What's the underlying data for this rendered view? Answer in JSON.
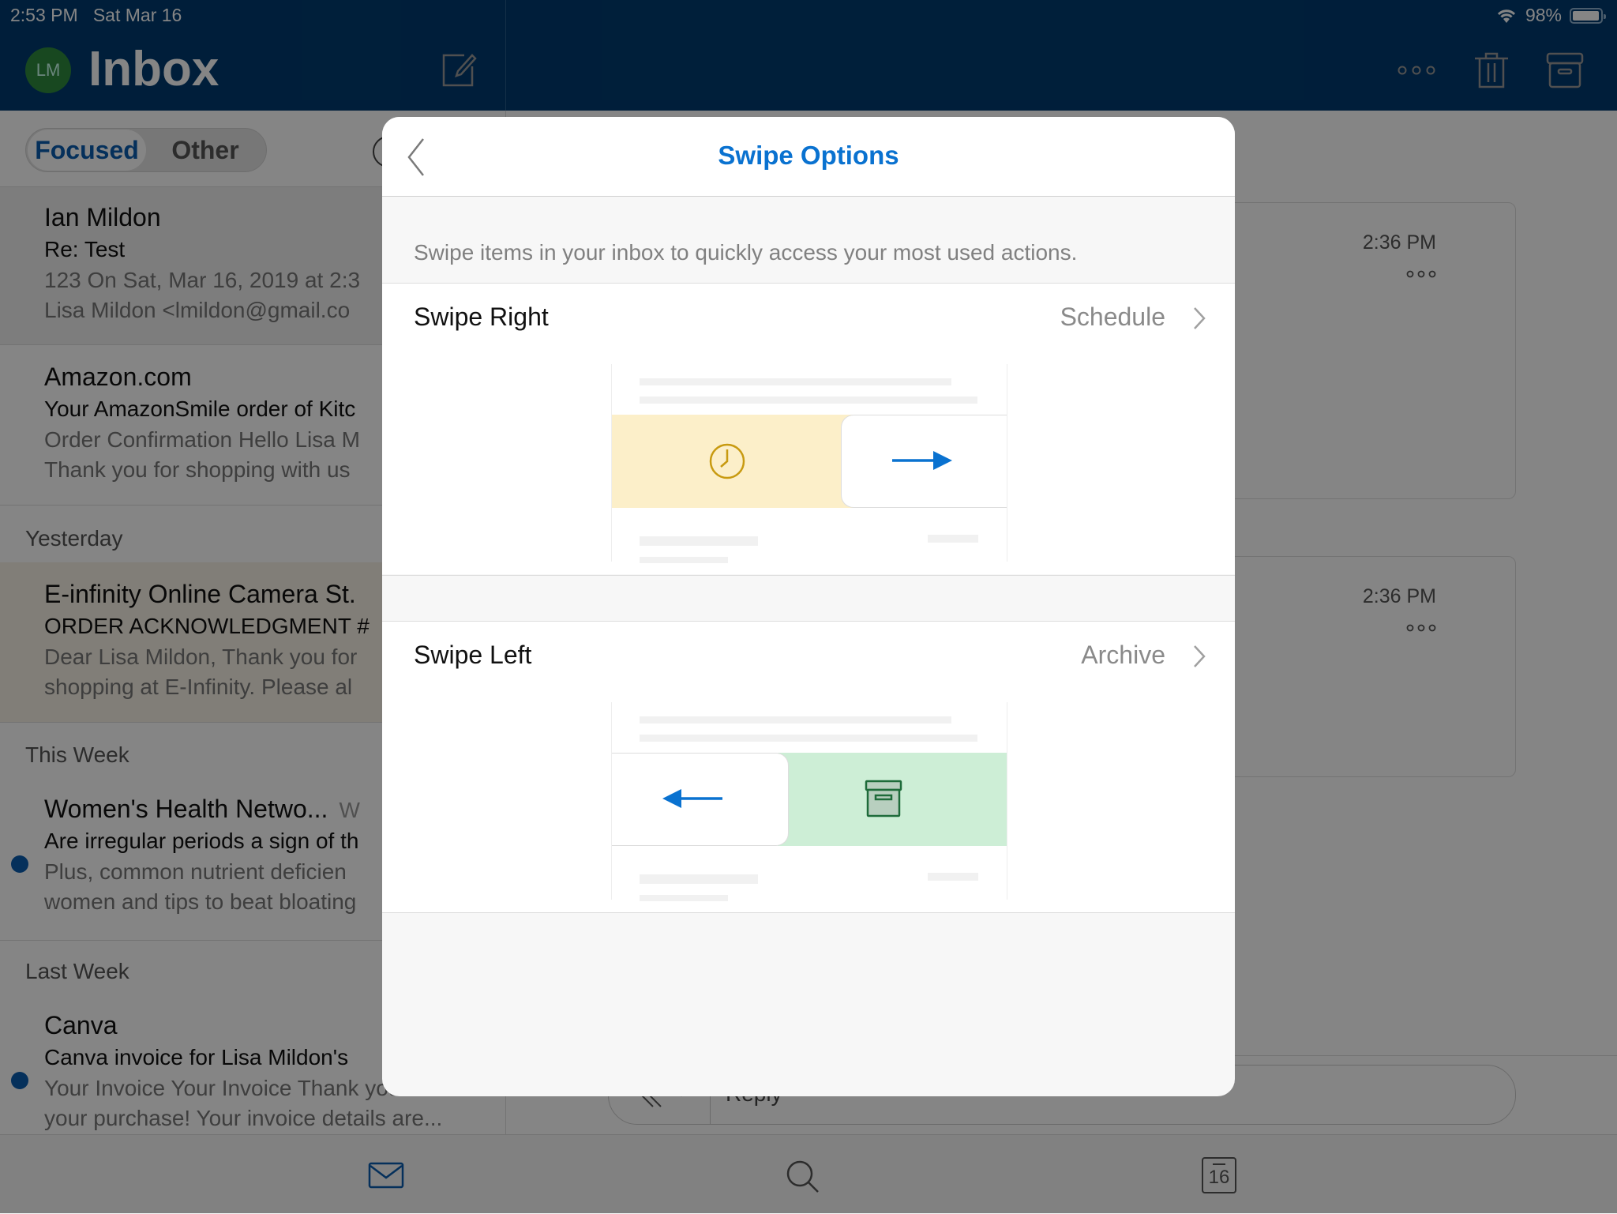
{
  "status_bar": {
    "time": "2:53 PM",
    "date": "Sat Mar 16",
    "battery_percent": "98%",
    "battery_level": 0.98
  },
  "header": {
    "avatar_initials": "LM",
    "title": "Inbox",
    "icons": [
      "compose-icon",
      "more-icon",
      "trash-icon",
      "archive-icon"
    ]
  },
  "colors": {
    "header_bg": "#003b6f",
    "accent": "#0a72d0",
    "schedule_bg": "#fcefc9",
    "schedule_icon": "#c89a10",
    "archive_bg": "#cdeed6",
    "archive_icon": "#1e6b3a",
    "unread_dot": "#0a5cae"
  },
  "inbox_tabs": {
    "focused": "Focused",
    "other": "Other",
    "active": "Focused"
  },
  "mail_list": {
    "items": [
      {
        "sender": "Ian Mildon",
        "subject": "Re: Test",
        "preview1": "123 On Sat, Mar 16, 2019 at 2:3",
        "preview2": "Lisa Mildon <lmildon@gmail.co",
        "unread": false
      },
      {
        "sender": "Amazon.com",
        "subject": "Your AmazonSmile order of Kitc",
        "preview1": "Order Confirmation Hello Lisa M",
        "preview2": "Thank you for shopping with us",
        "unread": false
      },
      {
        "sender": "E-infinity Online Camera St.",
        "subject": "ORDER ACKNOWLEDGMENT #",
        "preview1": "Dear Lisa Mildon, Thank you for",
        "preview2": "shopping at E-Infinity. Please al",
        "unread": false
      },
      {
        "sender": "Women's Health Netwo...",
        "sender_suffix": "W",
        "subject": "Are irregular periods a sign of th",
        "preview1": "Plus, common nutrient deficien",
        "preview2": "women and tips to beat bloating",
        "unread": true
      },
      {
        "sender": "Canva",
        "subject": "Canva invoice for Lisa Mildon's",
        "preview1": "Your Invoice Your Invoice Thank you for",
        "preview2": "your purchase! Your invoice details are...",
        "unread": true
      }
    ],
    "sections": [
      "Yesterday",
      "This Week",
      "Last Week"
    ]
  },
  "reading_pane": {
    "messages": [
      {
        "time": "2:36 PM"
      },
      {
        "time": "2:36 PM"
      }
    ],
    "reply_placeholder": "Reply"
  },
  "tab_bar": {
    "items": [
      "mail-icon",
      "search-icon",
      "calendar-icon"
    ],
    "calendar_day": "16"
  },
  "modal": {
    "title": "Swipe Options",
    "description": "Swipe items in your inbox to quickly access your most used actions.",
    "options": [
      {
        "label": "Swipe Right",
        "value": "Schedule",
        "illustration": "schedule",
        "direction": "right"
      },
      {
        "label": "Swipe Left",
        "value": "Archive",
        "illustration": "archive",
        "direction": "left"
      }
    ]
  }
}
